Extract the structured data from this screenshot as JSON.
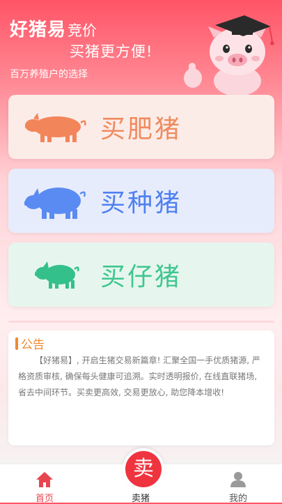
{
  "header": {
    "brand_name": "好猪易",
    "brand_suffix": "竞价",
    "slogan": "买猪更方便!",
    "subtitle": "百万养殖户的选择"
  },
  "cards": [
    {
      "label": "买肥猪",
      "color": "#f08a5e",
      "icon": "fat-pig-icon"
    },
    {
      "label": "买种猪",
      "color": "#4e80f0",
      "icon": "breeding-pig-icon"
    },
    {
      "label": "买仔猪",
      "color": "#3fc68e",
      "icon": "piglet-icon"
    }
  ],
  "notice": {
    "title": "公告",
    "body": "【好猪易】, 开启生猪交易新篇章! 汇聚全国一手优质猪源, 严格资质审核, 确保每头健康可追溯。实时透明报价, 在线直联猪场, 省去中间环节。买卖更高效, 交易更放心, 助您降本增收!"
  },
  "tabbar": {
    "home_label": "首页",
    "sell_label": "卖猪",
    "sell_glyph": "卖",
    "mine_label": "我的",
    "active_color": "#e8454f"
  }
}
